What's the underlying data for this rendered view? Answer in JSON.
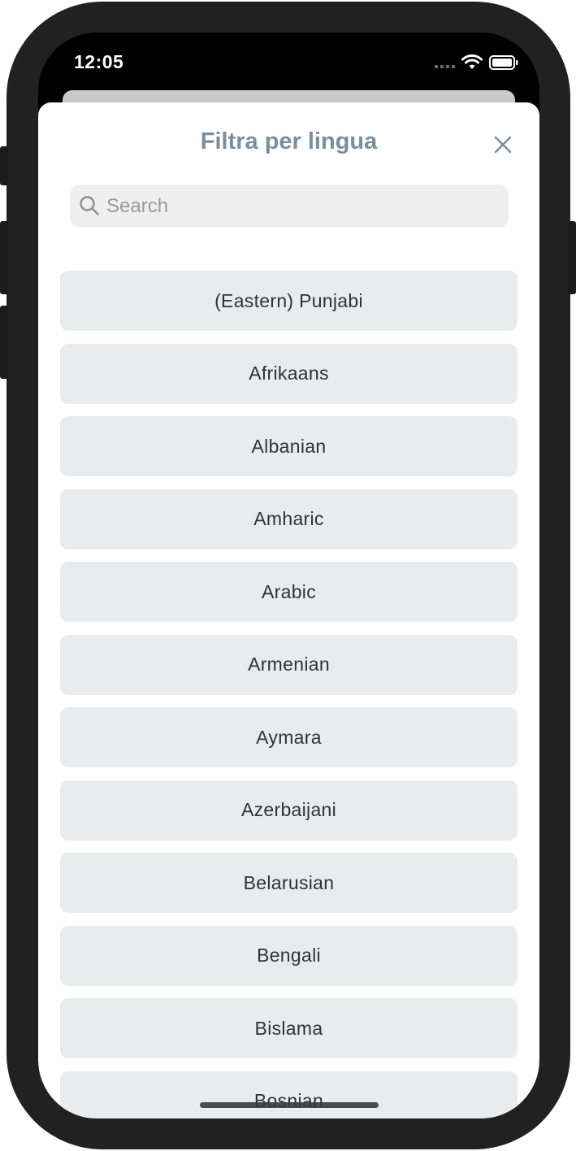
{
  "status_bar": {
    "time": "12:05",
    "icons": [
      "signal-dots-icon",
      "wifi-icon",
      "battery-icon"
    ]
  },
  "sheet": {
    "title": "Filtra per lingua",
    "close_icon": "close-icon"
  },
  "search": {
    "placeholder": "Search",
    "value": "",
    "icon": "search-icon"
  },
  "languages": [
    "(Eastern) Punjabi",
    "Afrikaans",
    "Albanian",
    "Amharic",
    "Arabic",
    "Armenian",
    "Aymara",
    "Azerbaijani",
    "Belarusian",
    "Bengali",
    "Bislama",
    "Bosnian"
  ],
  "colors": {
    "title": "#7a8f9b",
    "item_background": "#e9ecee",
    "item_text": "#2c3438",
    "search_background": "#efefef",
    "frame": "#212121"
  }
}
